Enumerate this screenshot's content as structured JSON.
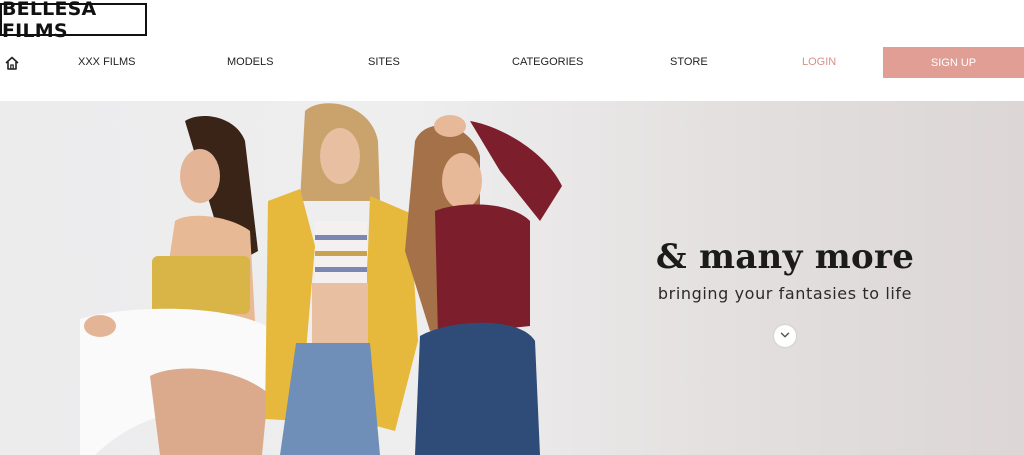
{
  "brand": {
    "logo_text": "BELLESA FILMS"
  },
  "nav": {
    "home_icon": "home-icon",
    "items": [
      {
        "label": "XXX FILMS"
      },
      {
        "label": "MODELS"
      },
      {
        "label": "SITES"
      },
      {
        "label": "CATEGORIES"
      },
      {
        "label": "STORE"
      }
    ],
    "login_label": "LOGIN",
    "signup_label": "SIGN UP"
  },
  "hero": {
    "heading": "& many more",
    "subheading": "bringing your fantasies to life",
    "scroll_icon": "chevron-down-icon"
  },
  "colors": {
    "accent": "#e09e95",
    "login_text": "#d98f86",
    "hero_background": "#e4e0e0"
  }
}
